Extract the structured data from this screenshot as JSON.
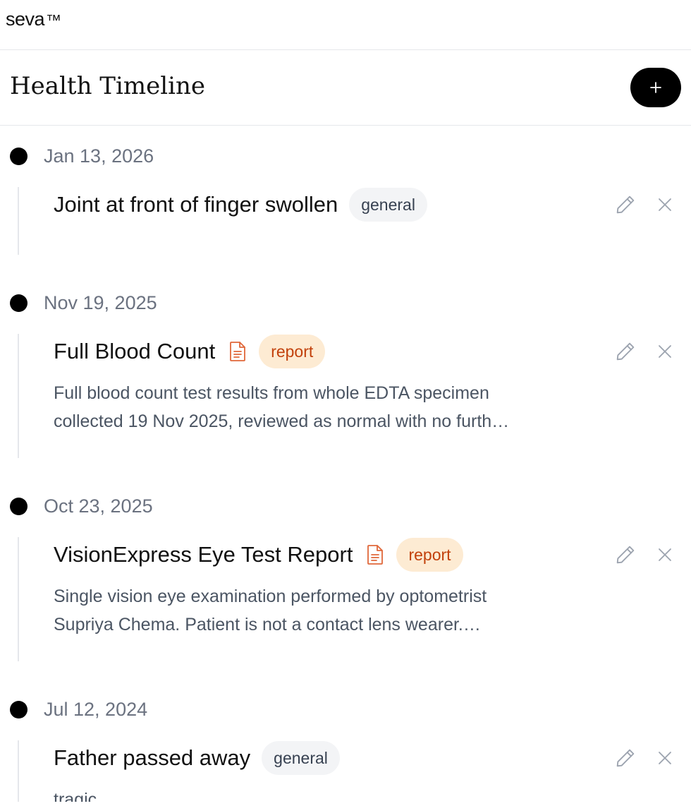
{
  "app": {
    "brand": "seva",
    "brand_mark": "™"
  },
  "header": {
    "title": "Health Timeline",
    "add_button_label": "+"
  },
  "entries": [
    {
      "date": "Jan 13, 2026",
      "title": "Joint at front of finger swollen",
      "has_document_icon": false,
      "tag": "general",
      "description_lines": []
    },
    {
      "date": "Nov 19, 2025",
      "title": "Full Blood Count",
      "has_document_icon": true,
      "tag": "report",
      "description_lines": [
        "Full blood count test results from whole EDTA specimen",
        "collected 19 Nov 2025, reviewed as normal with no furth…"
      ]
    },
    {
      "date": "Oct 23, 2025",
      "title": "VisionExpress Eye Test Report",
      "has_document_icon": true,
      "tag": "report",
      "description_lines": [
        "Single vision eye examination performed by optometrist",
        "Supriya Chema. Patient is not a contact lens wearer.…"
      ]
    },
    {
      "date": "Jul 12, 2024",
      "title": "Father passed away",
      "has_document_icon": false,
      "tag": "general",
      "description_lines": [
        "tragic"
      ]
    }
  ],
  "icons": {
    "edit": "pencil-icon",
    "delete": "close-icon",
    "document": "document-icon",
    "add": "plus-icon"
  },
  "colors": {
    "accent": "#000000",
    "report_tag_bg": "#fdebd3",
    "report_tag_text": "#c2410c",
    "general_tag_bg": "#f3f4f6",
    "muted_text": "#6b7280",
    "document_icon": "#e0683a"
  }
}
